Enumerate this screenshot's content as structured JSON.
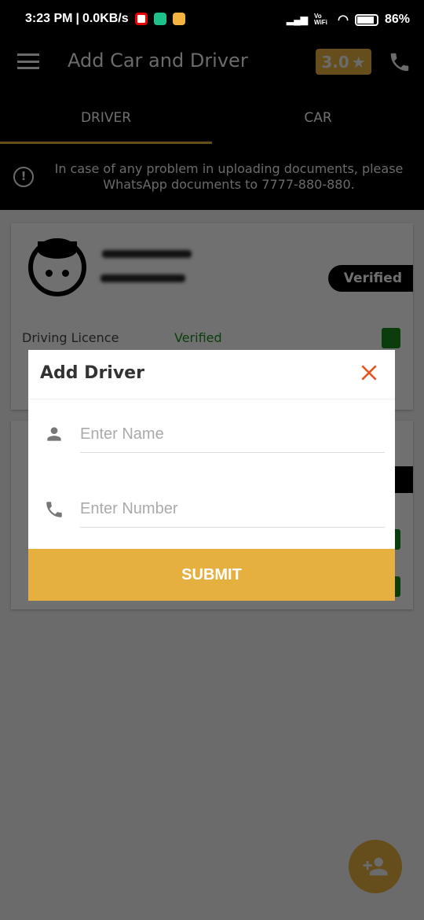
{
  "status_bar": {
    "time": "3:23 PM",
    "speed": "0.0KB/s",
    "network": "Vo WiFi",
    "battery": "86%"
  },
  "app_bar": {
    "title": "Add Car and Driver",
    "rating": "3.0",
    "rating_icon": "star-icon",
    "menu_icon": "hamburger-icon",
    "call_icon": "phone-icon"
  },
  "tabs": [
    {
      "label": "DRIVER",
      "active": true
    },
    {
      "label": "CAR",
      "active": false
    }
  ],
  "notice": {
    "text": "In case of any problem in uploading documents, please WhatsApp documents to 7777-880-880.",
    "icon": "alert-circle-icon"
  },
  "driver_card": {
    "status": "Verified",
    "rows": [
      {
        "label": "Driving Licence",
        "value": "Verified"
      }
    ]
  },
  "dialog": {
    "title": "Add Driver",
    "name_placeholder": "Enter Name",
    "number_placeholder": "Enter Number",
    "submit_label": "SUBMIT"
  },
  "colors": {
    "accent": "#e6b041",
    "verified": "#1a8a1a",
    "close": "#e8541e"
  },
  "fab": {
    "icon": "add-person-icon"
  }
}
